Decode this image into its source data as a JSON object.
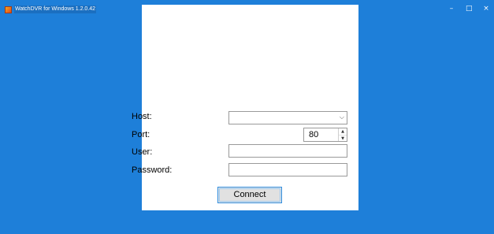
{
  "window": {
    "title": "WatchDVR for Windows 1.2.0.42",
    "icon": "app-icon",
    "controls": {
      "minimize": "–",
      "maximize": "□",
      "close": "×"
    }
  },
  "form": {
    "host": {
      "label": "Host:",
      "value": ""
    },
    "port": {
      "label": "Port:",
      "value": "80"
    },
    "user": {
      "label": "User:",
      "value": ""
    },
    "password": {
      "label": "Password:",
      "value": ""
    },
    "connect_label": "Connect"
  },
  "colors": {
    "background": "#1e7fd9",
    "panel": "#ffffff",
    "button_border": "#2f8ee0"
  }
}
